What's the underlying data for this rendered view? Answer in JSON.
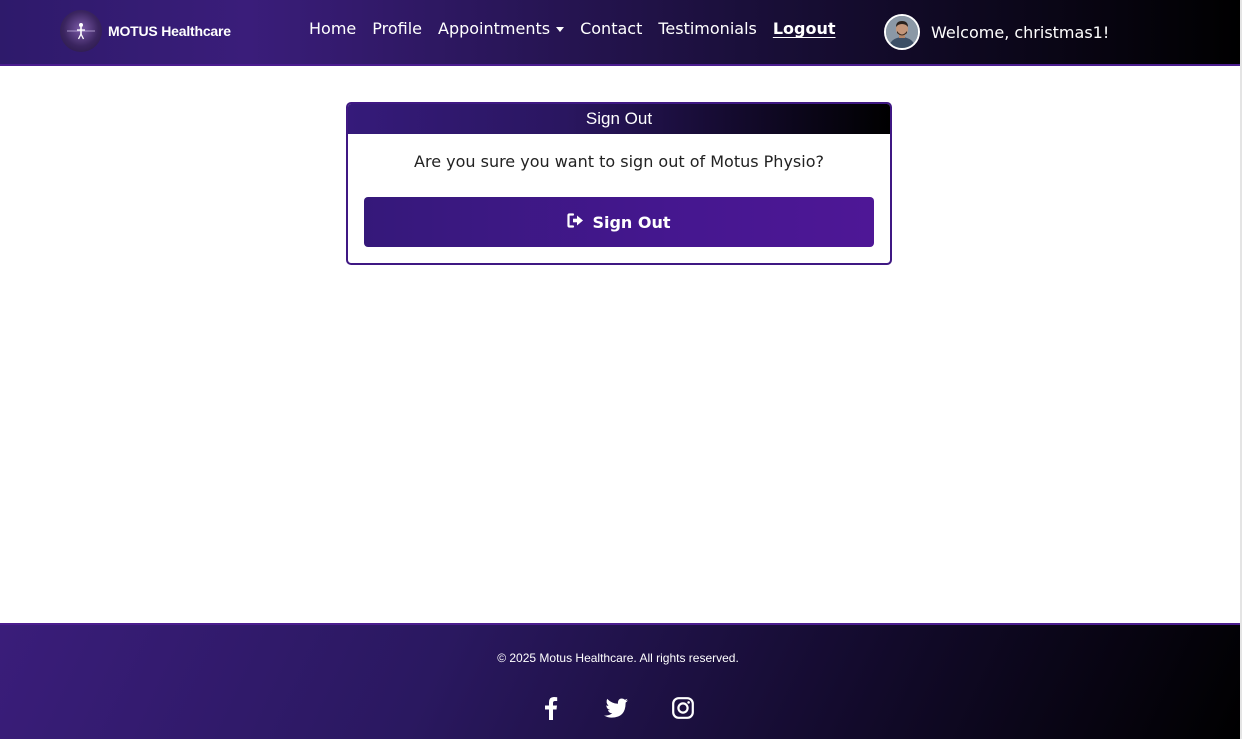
{
  "brand": {
    "name": "MOTUS Healthcare",
    "logo_icon": "figure-icon"
  },
  "nav": {
    "home": "Home",
    "profile": "Profile",
    "appointments": "Appointments",
    "contact": "Contact",
    "testimonials": "Testimonials",
    "logout": "Logout"
  },
  "user": {
    "welcome": "Welcome, christmas1!"
  },
  "card": {
    "title": "Sign Out",
    "message": "Are you sure you want to sign out of Motus Physio?",
    "button_label": "Sign Out",
    "button_icon": "sign-out-icon"
  },
  "footer": {
    "copyright": "© 2025 Motus Healthcare. All rights reserved.",
    "social": [
      "facebook-icon",
      "twitter-icon",
      "instagram-icon"
    ]
  },
  "colors": {
    "brand_purple": "#4b1d8f",
    "header_dark": "#000000",
    "button_purple": "#45178f"
  }
}
